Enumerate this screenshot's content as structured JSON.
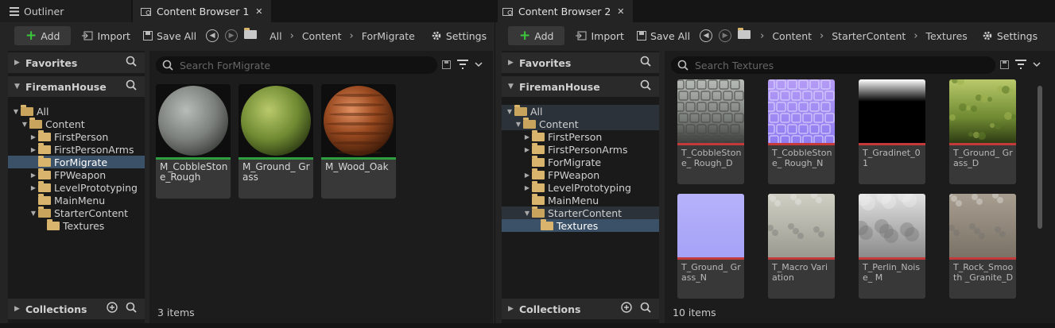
{
  "tabs": {
    "outliner": "Outliner",
    "cb1": "Content Browser 1",
    "cb2": "Content Browser 2",
    "close": "✕"
  },
  "cb1": {
    "toolbar": {
      "add": "Add",
      "import": "Import",
      "save_all": "Save All",
      "settings": "Settings",
      "breadcrumbs": [
        "All",
        "Content",
        "ForMigrate"
      ]
    },
    "favorites": "Favorites",
    "project": "FiremanHouse",
    "collections": "Collections",
    "tree": [
      {
        "label": "All",
        "indent": 0,
        "arrow": "▼",
        "open": true
      },
      {
        "label": "Content",
        "indent": 1,
        "arrow": "▼",
        "open": true
      },
      {
        "label": "FirstPerson",
        "indent": 2,
        "arrow": "▶"
      },
      {
        "label": "FirstPersonArms",
        "indent": 2,
        "arrow": "▶"
      },
      {
        "label": "ForMigrate",
        "indent": 2,
        "arrow": "",
        "selected": true
      },
      {
        "label": "FPWeapon",
        "indent": 2,
        "arrow": "▶"
      },
      {
        "label": "LevelPrototyping",
        "indent": 2,
        "arrow": "▶"
      },
      {
        "label": "MainMenu",
        "indent": 2,
        "arrow": ""
      },
      {
        "label": "StarterContent",
        "indent": 2,
        "arrow": "▼",
        "open": true
      },
      {
        "label": "Textures",
        "indent": 3,
        "arrow": ""
      }
    ],
    "search_placeholder": "Search ForMigrate",
    "status": "3 items",
    "assets": [
      {
        "name": "M_CobbleStone_Rough",
        "kind": "cobble"
      },
      {
        "name": "M_Ground_ Grass",
        "kind": "grass"
      },
      {
        "name": "M_Wood_Oak",
        "kind": "wood"
      }
    ]
  },
  "cb2": {
    "toolbar": {
      "add": "Add",
      "import": "Import",
      "save_all": "Save All",
      "settings": "Settings",
      "breadcrumbs": [
        "Content",
        "StarterContent",
        "Textures"
      ]
    },
    "favorites": "Favorites",
    "project": "FiremanHouse",
    "collections": "Collections",
    "tree": [
      {
        "label": "All",
        "indent": 0,
        "arrow": "▼",
        "open": true,
        "hl": true
      },
      {
        "label": "Content",
        "indent": 1,
        "arrow": "▼",
        "open": true,
        "hl": true
      },
      {
        "label": "FirstPerson",
        "indent": 2,
        "arrow": "▶"
      },
      {
        "label": "FirstPersonArms",
        "indent": 2,
        "arrow": "▶"
      },
      {
        "label": "ForMigrate",
        "indent": 2,
        "arrow": ""
      },
      {
        "label": "FPWeapon",
        "indent": 2,
        "arrow": "▶"
      },
      {
        "label": "LevelPrototyping",
        "indent": 2,
        "arrow": "▶"
      },
      {
        "label": "MainMenu",
        "indent": 2,
        "arrow": ""
      },
      {
        "label": "StarterContent",
        "indent": 2,
        "arrow": "▼",
        "open": true,
        "hl": true
      },
      {
        "label": "Textures",
        "indent": 3,
        "arrow": "",
        "selected": true
      }
    ],
    "search_placeholder": "Search Textures",
    "status": "10 items",
    "assets": [
      {
        "name": "T_CobbleStone_ Rough_D",
        "kind": "cobble"
      },
      {
        "name": "T_CobbleStone_ Rough_N",
        "kind": "normal"
      },
      {
        "name": "T_Gradinet_01",
        "kind": "gradient"
      },
      {
        "name": "T_Ground_ Grass_D",
        "kind": "grass"
      },
      {
        "name": "T_Ground_ Grass_N",
        "kind": "flatnormal"
      },
      {
        "name": "T_Macro Variation",
        "kind": "macro"
      },
      {
        "name": "T_Perlin_Noise_ M",
        "kind": "perlin"
      },
      {
        "name": "T_Rock_Smooth _Granite_D",
        "kind": "granite"
      }
    ]
  },
  "colors": {
    "material_bar": "#2e9e3e",
    "texture_bar": "#c43a3a",
    "selection": "#3b5168"
  }
}
